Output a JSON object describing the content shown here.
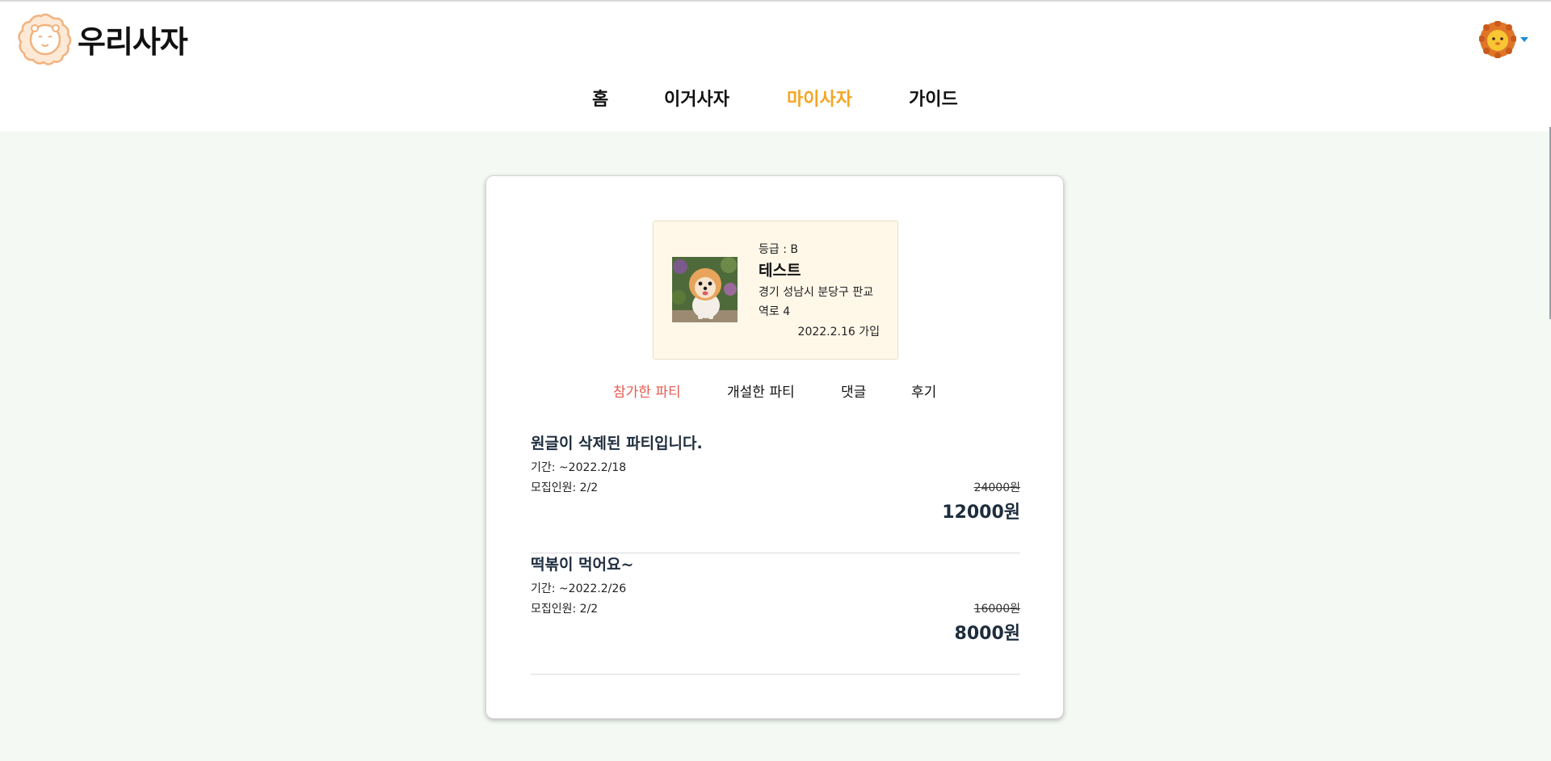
{
  "app": {
    "logo_text": "우리사자"
  },
  "nav": {
    "items": [
      {
        "label": "홈",
        "active": false
      },
      {
        "label": "이거사자",
        "active": false
      },
      {
        "label": "마이사자",
        "active": true
      },
      {
        "label": "가이드",
        "active": false
      }
    ]
  },
  "profile": {
    "grade": "등급 : B",
    "name": "테스트",
    "address": "경기 성남시 분당구 판교역로 4",
    "joined": "2022.2.16 가입"
  },
  "tabs": [
    {
      "label": "참가한 파티",
      "active": true
    },
    {
      "label": "개설한 파티",
      "active": false
    },
    {
      "label": "댓글",
      "active": false
    },
    {
      "label": "후기",
      "active": false
    }
  ],
  "parties": [
    {
      "title": "원글이 삭제된 파티입니다.",
      "period": "기간: ~2022.2/18",
      "members": "모집인원: 2/2",
      "original_price": "24000원",
      "price": "12000원"
    },
    {
      "title": "떡볶이 먹어요~",
      "period": "기간: ~2022.2/26",
      "members": "모집인원: 2/2",
      "original_price": "16000원",
      "price": "8000원"
    }
  ],
  "colors": {
    "accent": "#f5a524",
    "active_tab": "#e85a4f",
    "background": "#f4f9f3",
    "profile_bg": "#fff8e9"
  }
}
